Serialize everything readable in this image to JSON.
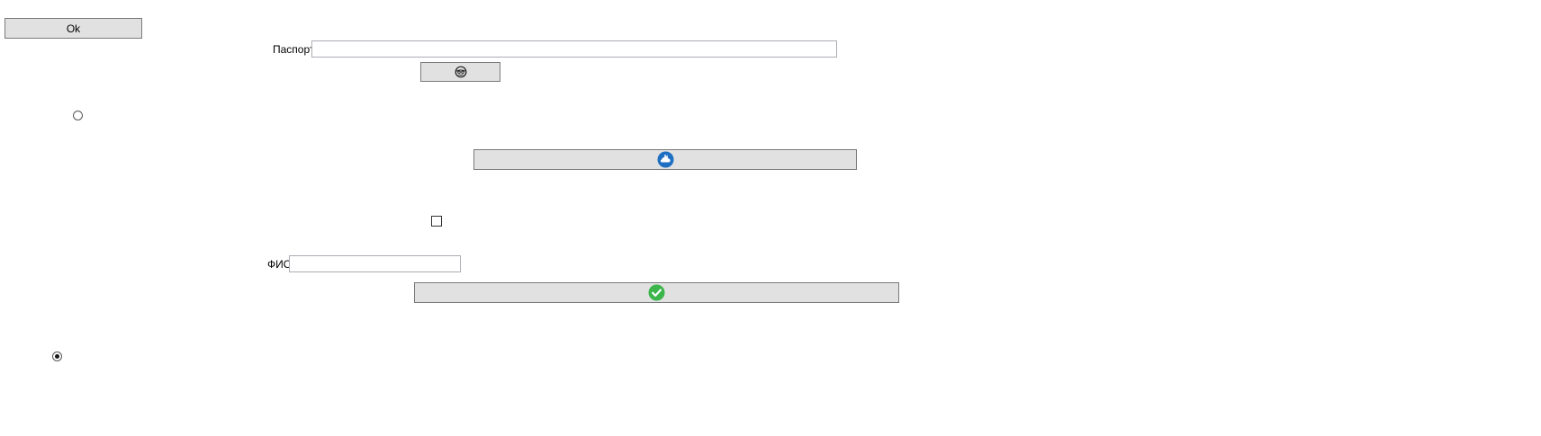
{
  "form": {
    "ok_button_label": "Ok",
    "passport_label": "Паспорт",
    "passport_value": "",
    "fio_label": "ФИО",
    "fio_value": "",
    "radio_1_checked": false,
    "radio_2_checked": true,
    "checkbox_checked": false
  },
  "icons": {
    "small_button_icon": "face-mask-icon",
    "wide_button_1_icon": "cloud-upload-icon",
    "wide_button_2_icon": "checkmark-icon"
  },
  "colors": {
    "button_bg": "#e1e1e1",
    "button_border": "#adadad",
    "cloud_icon_blue": "#1e6fc2",
    "check_icon_green": "#3cb54a"
  }
}
